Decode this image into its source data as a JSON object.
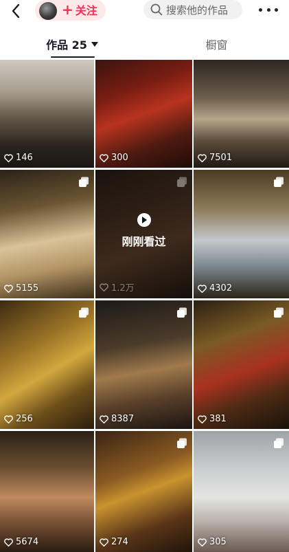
{
  "header": {
    "follow_label": "关注",
    "search_placeholder": "搜索他的作品"
  },
  "tabs": {
    "works_label": "作品 25",
    "window_label": "橱窗"
  },
  "grid": {
    "items": [
      {
        "likes": "146",
        "multi": false
      },
      {
        "likes": "300",
        "multi": false
      },
      {
        "likes": "7501",
        "multi": false
      },
      {
        "likes": "5155",
        "multi": true
      },
      {
        "likes": "1.2万",
        "multi": true,
        "overlay_text": "刚刚看过"
      },
      {
        "likes": "4302",
        "multi": true
      },
      {
        "likes": "256",
        "multi": true
      },
      {
        "likes": "8387",
        "multi": true
      },
      {
        "likes": "381",
        "multi": true
      },
      {
        "likes": "5674",
        "multi": false
      },
      {
        "likes": "274",
        "multi": true
      },
      {
        "likes": "305",
        "multi": true
      }
    ]
  },
  "colors": {
    "accent": "#fe2c55",
    "follow_bg": "#fde9ea",
    "search_bg": "#f1f1f2"
  }
}
